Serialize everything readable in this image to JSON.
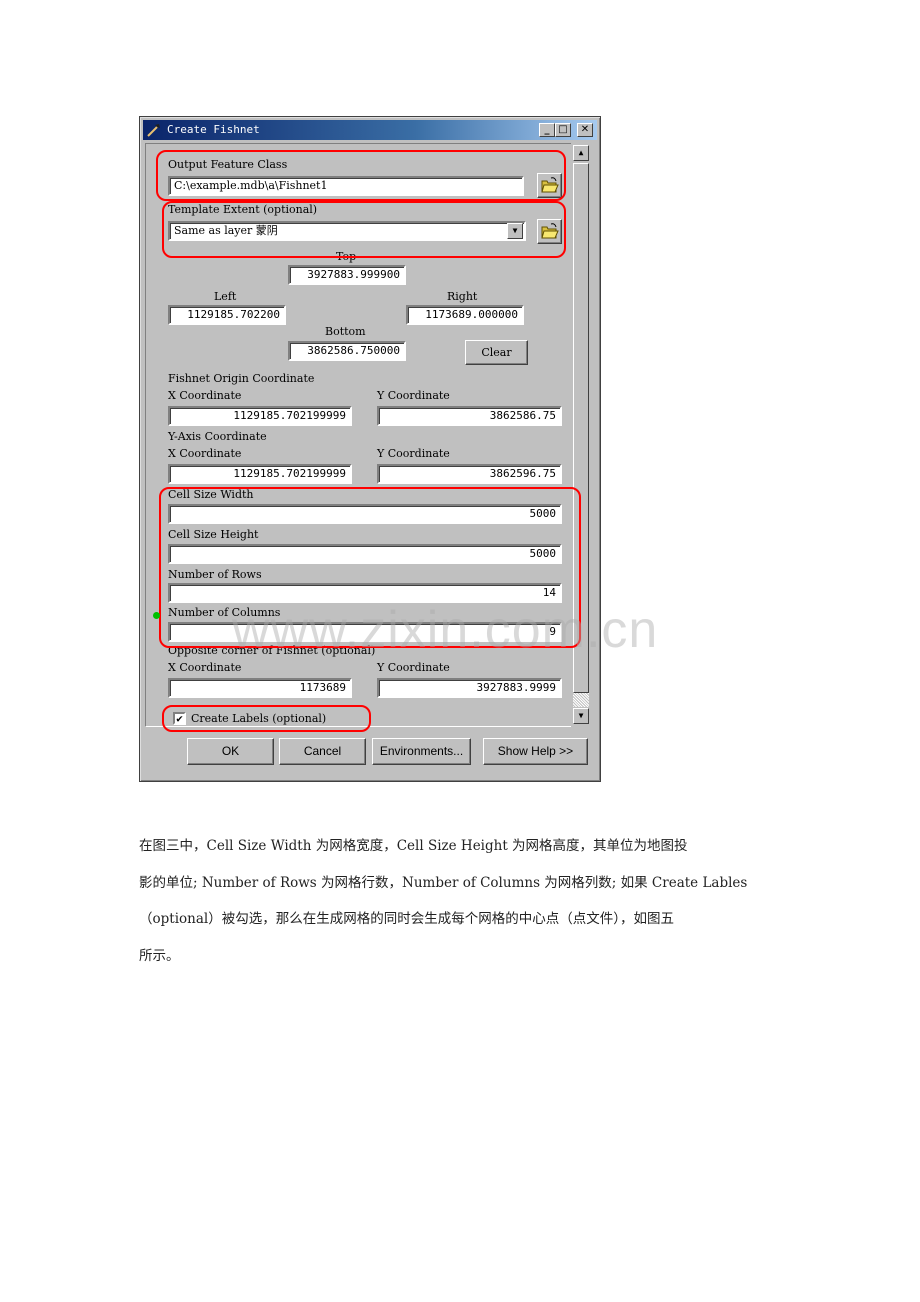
{
  "dialog": {
    "title": "Create Fishnet",
    "window_buttons": {
      "minimize": "_",
      "maximize": "□",
      "close": "✕"
    },
    "output_feature_class": {
      "label": "Output Feature Class",
      "value": "C:\\example.mdb\\a\\Fishnet1"
    },
    "template_extent": {
      "label": "Template Extent (optional)",
      "value": "Same as layer 蒙阴"
    },
    "extent": {
      "top_label": "Top",
      "top_value": "3927883.999900",
      "left_label": "Left",
      "left_value": "1129185.702200",
      "right_label": "Right",
      "right_value": "1173689.000000",
      "bottom_label": "Bottom",
      "bottom_value": "3862586.750000",
      "clear_label": "Clear"
    },
    "fishnet_origin": {
      "label": "Fishnet Origin Coordinate",
      "x_label": "X Coordinate",
      "x_value": "1129185.702199999",
      "y_label": "Y Coordinate",
      "y_value": "3862586.75"
    },
    "y_axis": {
      "label": "Y-Axis Coordinate",
      "x_label": "X Coordinate",
      "x_value": "1129185.702199999",
      "y_label": "Y Coordinate",
      "y_value": "3862596.75"
    },
    "cell_size_width": {
      "label": "Cell Size Width",
      "value": "5000"
    },
    "cell_size_height": {
      "label": "Cell Size Height",
      "value": "5000"
    },
    "number_of_rows": {
      "label": "Number of Rows",
      "value": "14"
    },
    "number_of_columns": {
      "label": "Number of Columns",
      "value": "9"
    },
    "opposite_corner": {
      "label": "Opposite corner of Fishnet (optional)",
      "x_label": "X Coordinate",
      "x_value": "1173689",
      "y_label": "Y Coordinate",
      "y_value": "3927883.9999"
    },
    "create_labels": {
      "label": "Create Labels (optional)",
      "checked": true,
      "mark": "✔"
    },
    "buttons": {
      "ok": "OK",
      "cancel": "Cancel",
      "environments": "Environments...",
      "show_help": "Show Help >>"
    },
    "scrollbar": {
      "up": "▲",
      "down": "▼"
    },
    "dropdown_arrow": "▼"
  },
  "watermark": "www.zixin.com.cn",
  "paragraph": {
    "lines": [
      "在图三中，Cell Size Width 为网格宽度，Cell Size Height 为网格高度，其单位为地图投",
      "影的单位; Number of Rows 为网格行数，Number of Columns 为网格列数; 如果 Create Lables",
      "（optional）被勾选，那么在生成网格的同时会生成每个网格的中心点（点文件），如图五",
      "所示。"
    ]
  }
}
